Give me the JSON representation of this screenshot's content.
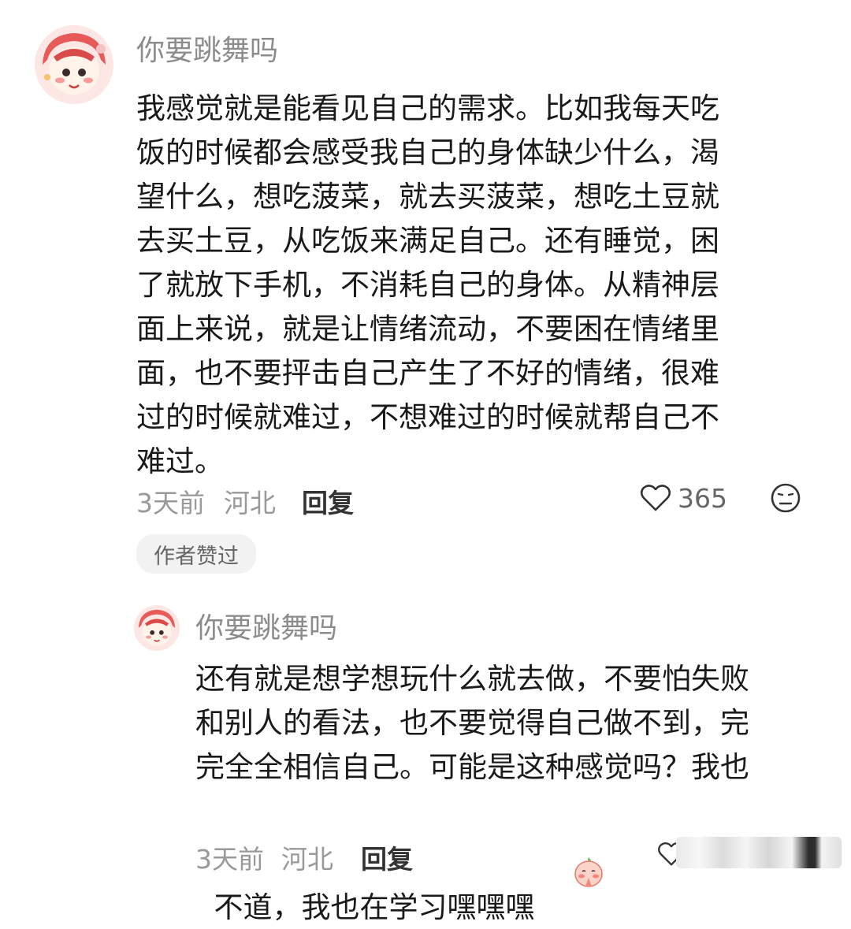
{
  "comment": {
    "username": "你要跳舞吗",
    "text_lines": [
      "我感觉就是能看见自己的需求。比如我每天吃",
      "饭的时候都会感受我自己的身体缺少什么，渴",
      "望什么，想吃菠菜，就去买菠菜，想吃土豆就",
      "去买土豆，从吃饭来满足自己。还有睡觉，困",
      "了就放下手机，不消耗自己的身体。从精神层",
      "面上来说，就是让情绪流动，不要困在情绪里",
      "面，也不要抨击自己产生了不好的情绪，很难",
      "过的时候就难过，不想难过的时候就帮自己不",
      "难过。"
    ],
    "time": "3天前",
    "location": "河北",
    "reply_label": "回复",
    "likes": "365",
    "author_badge": "作者赞过",
    "icons": {
      "like": "heart-outline-icon",
      "dislike": "neutral-face-icon"
    }
  },
  "reply": {
    "username": "你要跳舞吗",
    "text_lines": [
      "还有就是想学想玩什么就去做，不要怕失败",
      "和别人的看法，也不要觉得自己做不到，完",
      "完全全相信自己。可能是这种感觉吗？我也"
    ],
    "last_line_text": "不道，我也在学习嘿嘿嘿",
    "emoji": "blushing-pray-emoji-icon",
    "time": "3天前",
    "location": "河北",
    "reply_label": "回复"
  },
  "colors": {
    "username": "#8c8c8c",
    "body_text": "#1a1a1a",
    "meta_text": "#999999",
    "badge_bg": "#f2f2f2"
  }
}
